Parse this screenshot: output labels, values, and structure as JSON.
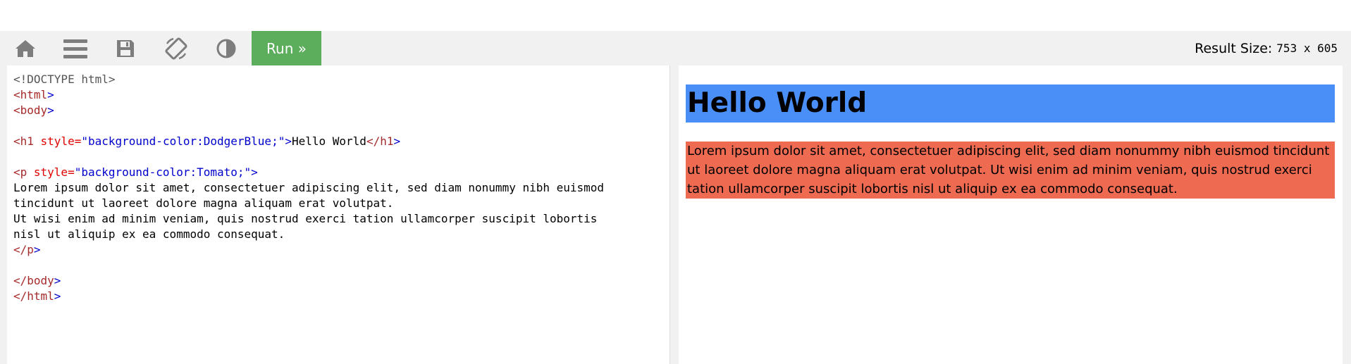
{
  "toolbar": {
    "icons": [
      "home-icon",
      "menu-icon",
      "save-icon",
      "rotate-icon",
      "contrast-icon"
    ],
    "run_label": "Run »",
    "result_size_label": "Result Size:",
    "result_size_value": "753 x 605"
  },
  "editor": {
    "lines": [
      "<!DOCTYPE html>",
      "<html>",
      "<body>",
      "",
      "<h1 style=\"background-color:DodgerBlue;\">Hello World</h1>",
      "",
      "<p style=\"background-color:Tomato;\">",
      "Lorem ipsum dolor sit amet, consectetuer adipiscing elit, sed diam nonummy nibh euismod",
      "tincidunt ut laoreet dolore magna aliquam erat volutpat.",
      "Ut wisi enim ad minim veniam, quis nostrud exerci tation ullamcorper suscipit lobortis",
      "nisl ut aliquip ex ea commodo consequat.",
      "</p>",
      "",
      "</body>",
      "</html>"
    ]
  },
  "result": {
    "heading": "Hello World",
    "heading_bg": "#4a8ff8",
    "paragraph": "Lorem ipsum dolor sit amet, consectetuer adipiscing elit, sed diam nonummy nibh euismod tincidunt ut laoreet dolore magna aliquam erat volutpat. Ut wisi enim ad minim veniam, quis nostrud exerci tation ullamcorper suscipit lobortis nisl ut aliquip ex ea commodo consequat.",
    "paragraph_bg": "#ee6b52"
  },
  "colors": {
    "toolbar_bg": "#f1f1f1",
    "icon": "#7d7d7d",
    "run_button": "#5cae5c"
  }
}
